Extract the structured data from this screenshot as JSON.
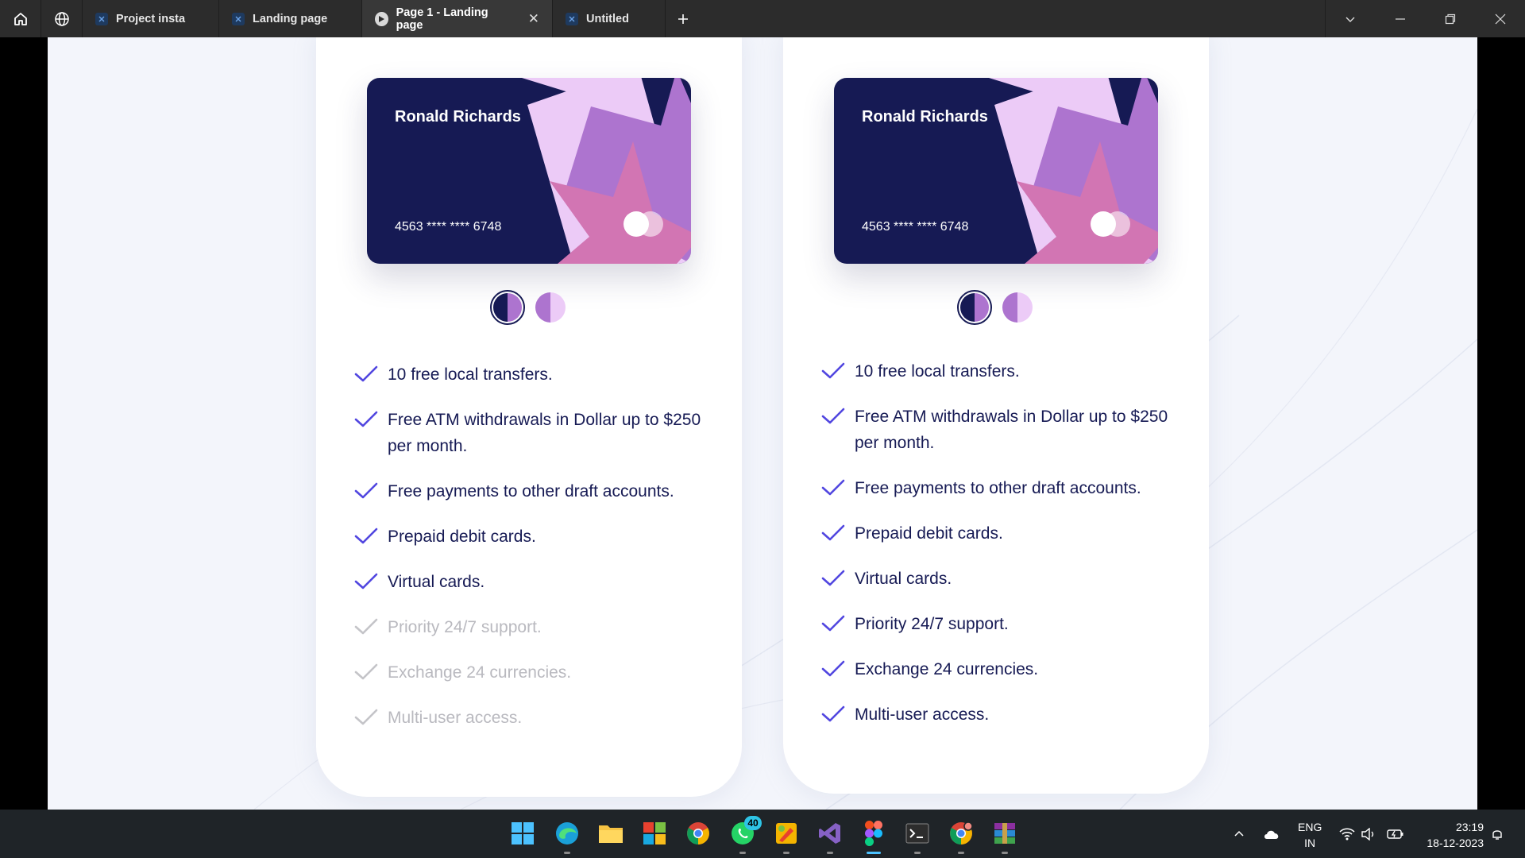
{
  "titlebar": {
    "tabs": [
      {
        "label": "Project insta",
        "icon": "figma-file-icon"
      },
      {
        "label": "Landing page",
        "icon": "figma-file-icon"
      },
      {
        "label": "Page 1 - Landing page",
        "icon": "play-icon",
        "active": true
      },
      {
        "label": "Untitled",
        "icon": "figma-file-icon"
      }
    ]
  },
  "cards": [
    {
      "holder": "Ronald Richards",
      "number": "4563 **** **** 6748",
      "features": [
        {
          "text": "10 free local transfers.",
          "enabled": true
        },
        {
          "text": "Free ATM withdrawals in Dollar up to $250 per month.",
          "enabled": true
        },
        {
          "text": "Free payments to other draft accounts.",
          "enabled": true
        },
        {
          "text": "Prepaid debit cards.",
          "enabled": true
        },
        {
          "text": "Virtual cards.",
          "enabled": true
        },
        {
          "text": "Priority 24/7 support.",
          "enabled": false
        },
        {
          "text": "Exchange 24 currencies.",
          "enabled": false
        },
        {
          "text": "Multi-user access.",
          "enabled": false
        }
      ]
    },
    {
      "holder": "Ronald Richards",
      "number": "4563 **** **** 6748",
      "features": [
        {
          "text": "10 free local transfers.",
          "enabled": true
        },
        {
          "text": "Free ATM withdrawals in Dollar up to $250 per month.",
          "enabled": true
        },
        {
          "text": "Free payments to other draft accounts.",
          "enabled": true
        },
        {
          "text": "Prepaid debit cards.",
          "enabled": true
        },
        {
          "text": "Virtual cards.",
          "enabled": true
        },
        {
          "text": "Priority 24/7 support.",
          "enabled": true
        },
        {
          "text": "Exchange 24 currencies.",
          "enabled": true
        },
        {
          "text": "Multi-user access.",
          "enabled": true
        }
      ]
    }
  ],
  "colors": {
    "card_navy": "#161a54",
    "accent_purple": "#5146e0",
    "muted_text": "#b9b9bf",
    "star_light": "#eccbf7",
    "star_mid": "#ad74cf",
    "star_pink": "#d275b3"
  },
  "taskbar": {
    "apps": [
      "windows-start-icon",
      "edge-icon",
      "file-explorer-icon",
      "app-icon",
      "chrome-icon",
      "whatsapp-icon",
      "paint-icon",
      "visual-studio-icon",
      "figma-icon",
      "terminal-icon",
      "chrome-profile-icon",
      "winrar-icon"
    ],
    "whatsapp_badge": "40",
    "lang_line1": "ENG",
    "lang_line2": "IN",
    "time": "23:19",
    "date": "18-12-2023"
  }
}
